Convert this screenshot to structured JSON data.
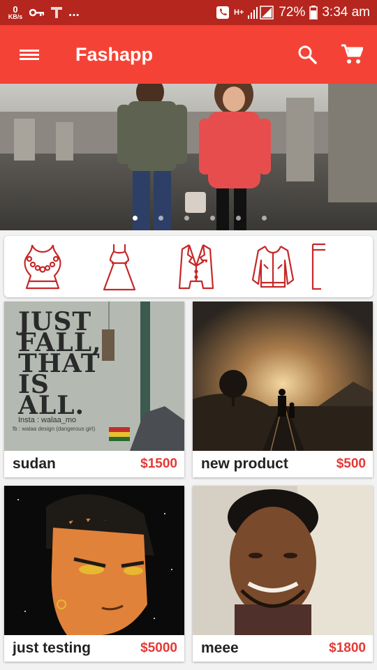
{
  "status_bar": {
    "speed_value": "0",
    "speed_unit": "KB/s",
    "network": "H+",
    "battery": "72%",
    "time": "3:34 am",
    "dots": "..."
  },
  "app_bar": {
    "title": "Fashapp"
  },
  "banner": {
    "slide_count": 6,
    "active_slide": 0
  },
  "categories": [
    {
      "icon": "necklace-icon"
    },
    {
      "icon": "dress-icon"
    },
    {
      "icon": "suit-jacket-icon"
    },
    {
      "icon": "bomber-jacket-icon"
    },
    {
      "icon": "pants-icon"
    }
  ],
  "products": [
    {
      "name": "sudan",
      "price": "$1500",
      "image_text": [
        "JUST",
        "FALL,",
        "THAT",
        "IS",
        "ALL."
      ],
      "credit1": "Insta : walaa_mo",
      "credit2": "fb : walaa design (dangerous girl)"
    },
    {
      "name": "new product",
      "price": "$500"
    },
    {
      "name": "just testing",
      "price": "$5000"
    },
    {
      "name": "meee",
      "price": "$1800"
    }
  ],
  "colors": {
    "primary": "#f44336",
    "primary_dark": "#b5261e",
    "accent_price": "#e53935",
    "icon_stroke": "#c62828"
  }
}
